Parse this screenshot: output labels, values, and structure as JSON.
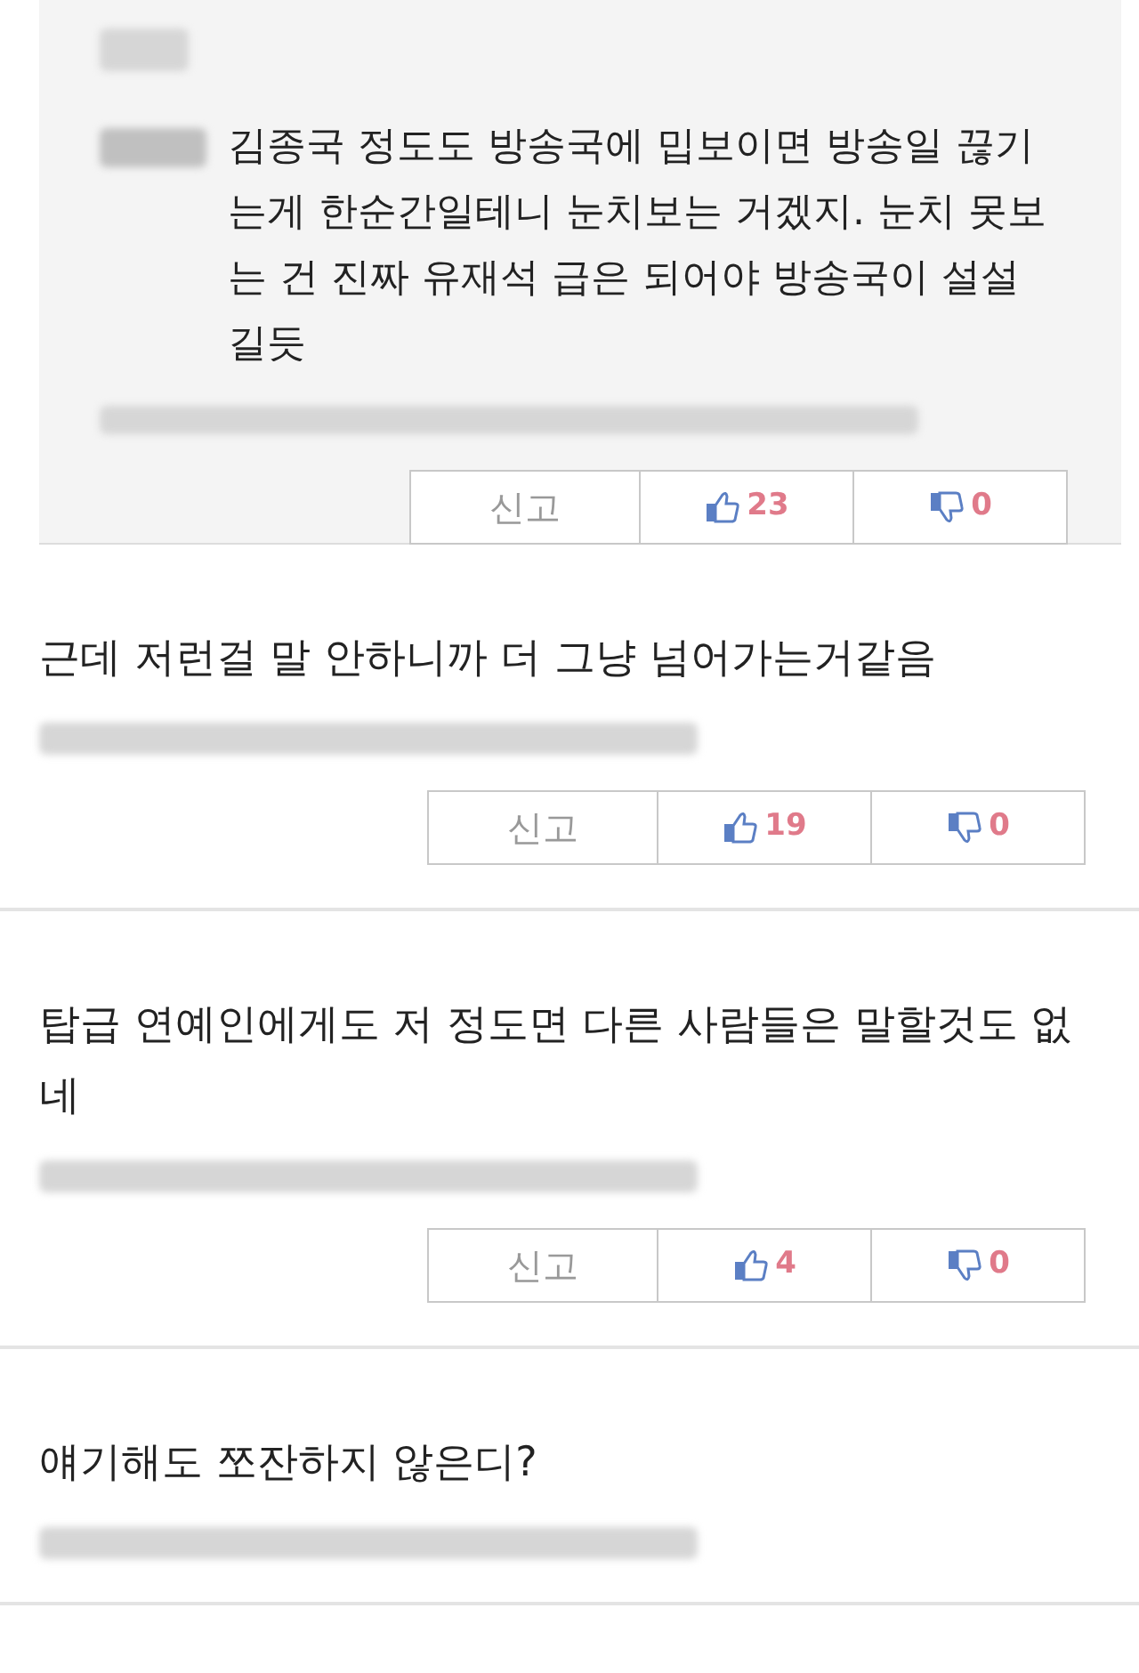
{
  "comments": [
    {
      "kind": "reply",
      "text": "김종국 정도도 방송국에 밉보이면 방송일 끊기는게 한순간일테니 눈치보는 거겠지. 눈치 못보는 건 진짜 유재석 급은 되어야 방송국이 설설 길듯",
      "report": "신고",
      "likes": "23",
      "dislikes": "0"
    },
    {
      "kind": "comment",
      "text": "근데 저런걸 말 안하니까 더 그냥 넘어가는거같음",
      "report": "신고",
      "likes": "19",
      "dislikes": "0"
    },
    {
      "kind": "comment",
      "text": "탑급 연예인에게도 저 정도면 다른 사람들은 말할것도 없네",
      "report": "신고",
      "likes": "4",
      "dislikes": "0"
    },
    {
      "kind": "comment",
      "text": "얘기해도 쪼잔하지 않은디?"
    }
  ]
}
